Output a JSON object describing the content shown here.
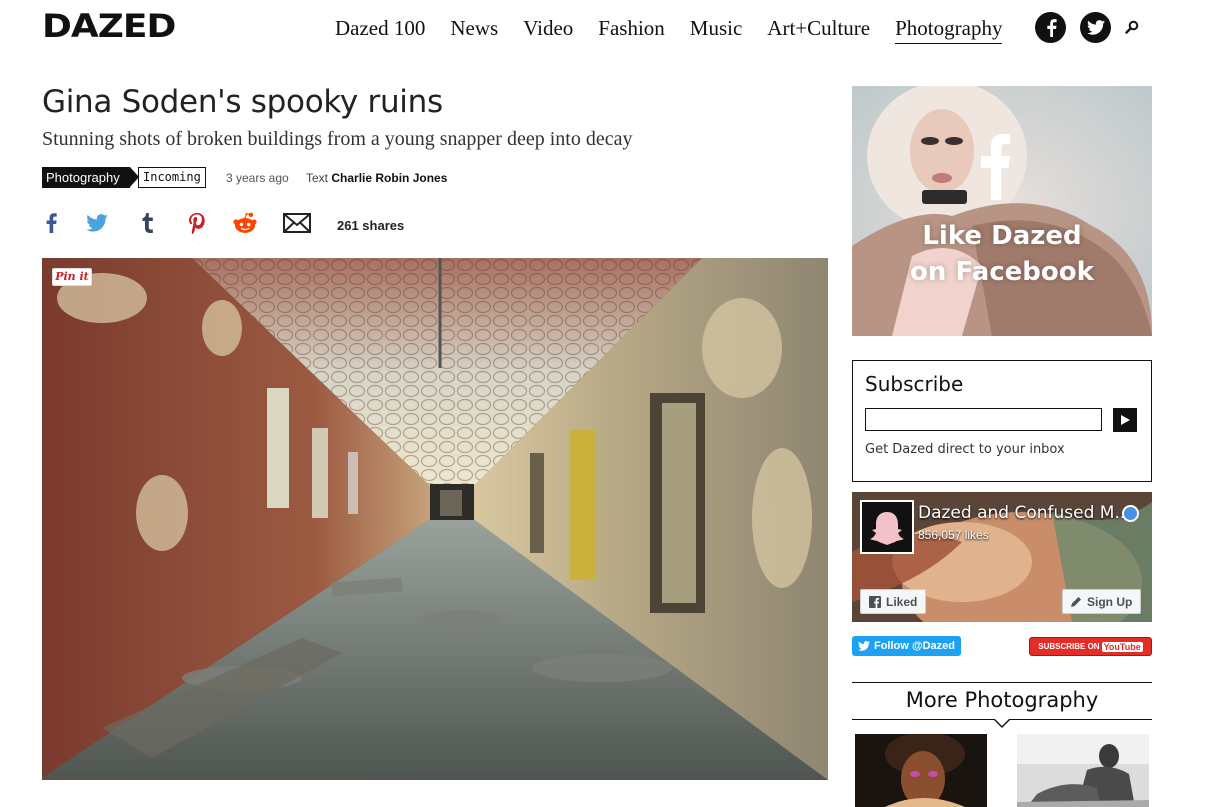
{
  "header": {
    "logo": "DAZED",
    "nav": [
      "Dazed 100",
      "News",
      "Video",
      "Fashion",
      "Music",
      "Art+Culture",
      "Photography"
    ],
    "active_nav": "Photography",
    "icons": [
      "facebook-icon",
      "twitter-icon",
      "search-icon"
    ]
  },
  "article": {
    "title": "Gina Soden's spooky ruins",
    "subtitle": "Stunning shots of broken buildings from a young snapper deep into decay",
    "tag_primary": "Photography",
    "tag_secondary": "Incoming",
    "time": "3 years ago",
    "author_prefix": "Text",
    "author": "Charlie Robin Jones",
    "share_icons": [
      "facebook-icon",
      "twitter-icon",
      "tumblr-icon",
      "pinterest-icon",
      "reddit-icon",
      "email-icon"
    ],
    "shares": "261 shares",
    "pin_label": "Pin it"
  },
  "sidebar": {
    "fb_promo_line1": "Like Dazed",
    "fb_promo_line2": "on Facebook",
    "subscribe": {
      "title": "Subscribe",
      "placeholder": "",
      "hint": "Get Dazed direct to your inbox"
    },
    "fb_page": {
      "name": "Dazed and Confused M...",
      "likes": "856,057 likes",
      "liked_label": "Liked",
      "signup_label": "Sign Up"
    },
    "twitter_follow": "Follow @Dazed",
    "youtube_subscribe": "SUBSCRIBE ON",
    "youtube_brand": "YouTube",
    "more_title": "More Photography"
  },
  "colors": {
    "brand_black": "#111111",
    "facebook": "#3b5998",
    "twitter": "#1da1f2",
    "tumblr": "#35465c",
    "pinterest": "#cb2027",
    "reddit": "#ff4500",
    "youtube": "#e52d27"
  }
}
